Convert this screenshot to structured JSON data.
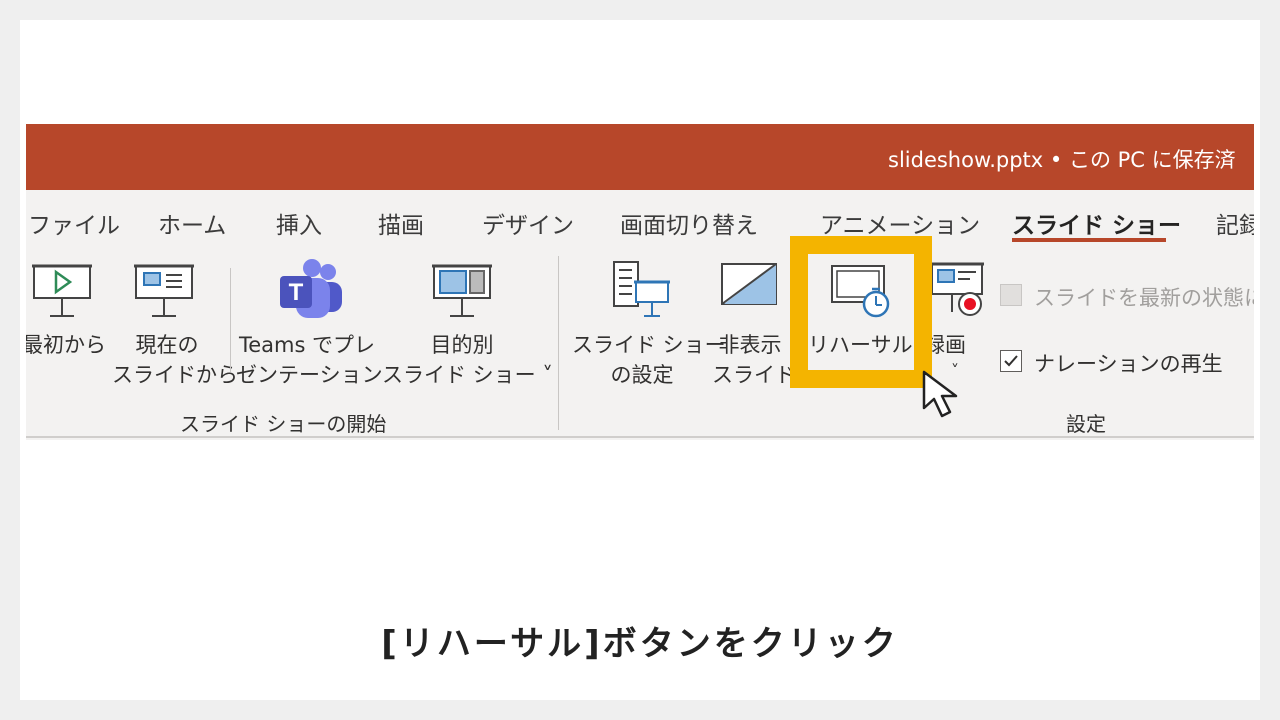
{
  "window": {
    "doc_title": "slideshow.pptx • この PC に保存済"
  },
  "tabs": [
    {
      "label": "ファイル"
    },
    {
      "label": "ホーム"
    },
    {
      "label": "挿入"
    },
    {
      "label": "描画"
    },
    {
      "label": "デザイン"
    },
    {
      "label": "画面切り替え"
    },
    {
      "label": "アニメーション"
    },
    {
      "label": "スライド ショー"
    },
    {
      "label": "記録"
    }
  ],
  "active_tab": "スライド ショー",
  "ribbon": {
    "start_group": {
      "label": "スライド ショーの開始",
      "from_beginning": {
        "line1": "最初から"
      },
      "from_current": {
        "line1": "現在の",
        "line2": "スライドから"
      },
      "teams": {
        "line1": "Teams でプレ",
        "line2": "ゼンテーション"
      },
      "custom": {
        "line1": "目的別",
        "line2": "スライド ショー ˅"
      }
    },
    "setup_group": {
      "label": "設定",
      "setup": {
        "line1": "スライド ショー",
        "line2": "の設定"
      },
      "hide": {
        "line1": "非表示",
        "line2": "スライド"
      },
      "rehearse": {
        "line1": "リハーサル"
      },
      "record": {
        "line1": "録画",
        "line2": "˅"
      },
      "keep_updated": {
        "label": "スライドを最新の状態に",
        "checked": false,
        "enabled": false
      },
      "play_narrations": {
        "label": "ナレーションの再生",
        "checked": true,
        "enabled": true
      }
    }
  },
  "caption": "[リハーサル]ボタンをクリック",
  "colors": {
    "titlebar": "#b7472a",
    "highlight": "#f4b400",
    "teams": "#5b5fc7",
    "record": "#e81123"
  }
}
